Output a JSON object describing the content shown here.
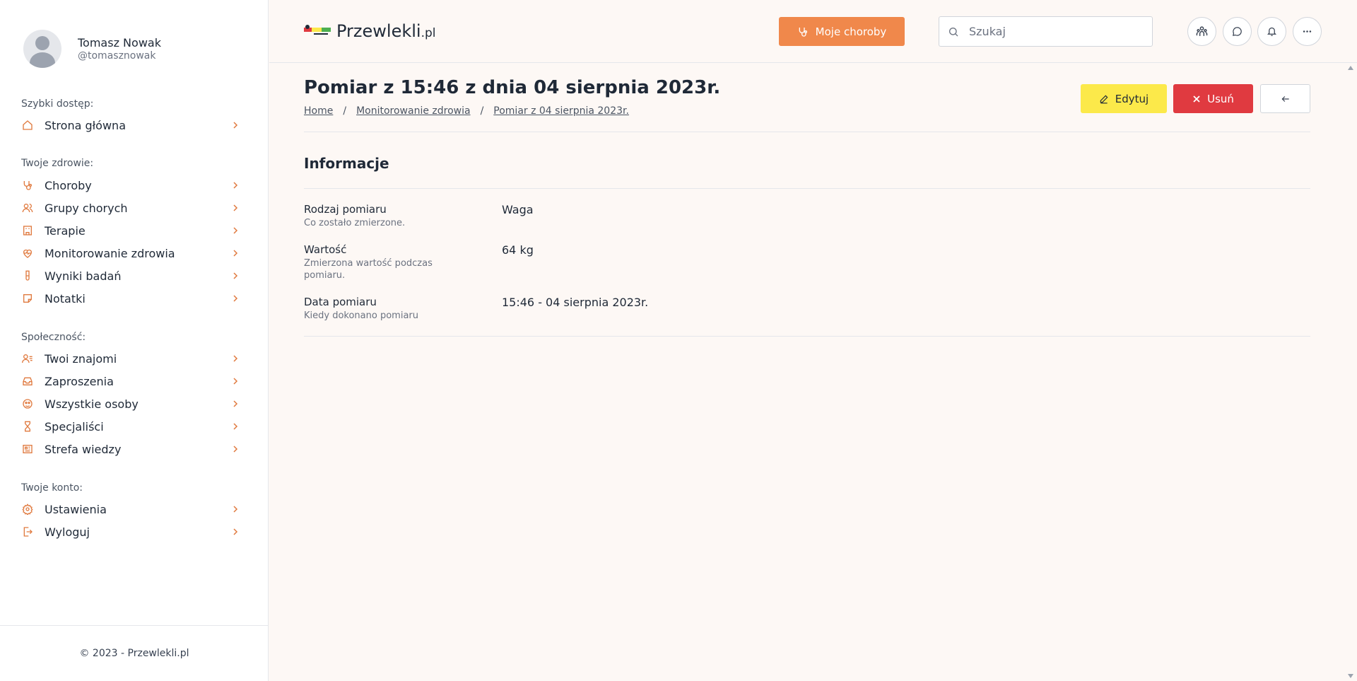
{
  "profile": {
    "name": "Tomasz Nowak",
    "handle": "@tomasznowak"
  },
  "sidebar": {
    "sections": [
      {
        "title": "Szybki dostęp:",
        "items": [
          {
            "label": "Strona główna",
            "icon": "home-icon"
          }
        ]
      },
      {
        "title": "Twoje zdrowie:",
        "items": [
          {
            "label": "Choroby",
            "icon": "stethoscope-icon"
          },
          {
            "label": "Grupy chorych",
            "icon": "users-icon"
          },
          {
            "label": "Terapie",
            "icon": "building-icon"
          },
          {
            "label": "Monitorowanie zdrowia",
            "icon": "heart-pulse-icon"
          },
          {
            "label": "Wyniki badań",
            "icon": "test-tube-icon"
          },
          {
            "label": "Notatki",
            "icon": "sticky-note-icon"
          }
        ]
      },
      {
        "title": "Społeczność:",
        "items": [
          {
            "label": "Twoi znajomi",
            "icon": "user-list-icon"
          },
          {
            "label": "Zaproszenia",
            "icon": "inbox-icon"
          },
          {
            "label": "Wszystkie osoby",
            "icon": "people-circle-icon"
          },
          {
            "label": "Specjaliści",
            "icon": "hourglass-icon"
          },
          {
            "label": "Strefa wiedzy",
            "icon": "newspaper-icon"
          }
        ]
      },
      {
        "title": "Twoje konto:",
        "items": [
          {
            "label": "Ustawienia",
            "icon": "gear-icon"
          },
          {
            "label": "Wyloguj",
            "icon": "logout-icon"
          }
        ]
      }
    ],
    "footer": "© 2023 - Przewlekli.pl"
  },
  "header": {
    "logo_text": "Przewlekli",
    "logo_suffix": ".pl",
    "primary_button": "Moje choroby",
    "search_placeholder": "Szukaj"
  },
  "page": {
    "title": "Pomiar z 15:46 z dnia 04 sierpnia 2023r.",
    "breadcrumb": [
      "Home",
      "Monitorowanie zdrowia",
      "Pomiar z 04 sierpnia 2023r."
    ],
    "edit_label": "Edytuj",
    "delete_label": "Usuń",
    "section_title": "Informacje",
    "rows": [
      {
        "label": "Rodzaj pomiaru",
        "desc": "Co zostało zmierzone.",
        "value": "Waga"
      },
      {
        "label": "Wartość",
        "desc": "Zmierzona wartość podczas pomiaru.",
        "value": "64 kg"
      },
      {
        "label": "Data pomiaru",
        "desc": "Kiedy dokonano pomiaru",
        "value": "15:46 - 04 sierpnia 2023r."
      }
    ]
  },
  "colors": {
    "accent": "#f0884b",
    "edit": "#fce94a",
    "delete": "#e03a40",
    "icon": "#e07a3f"
  }
}
